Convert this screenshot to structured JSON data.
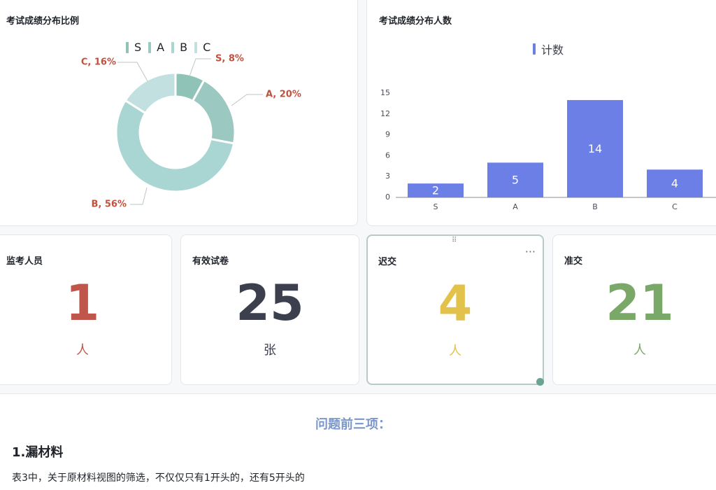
{
  "charts": {
    "donut": {
      "title": "考试成绩分布比例",
      "legend": [
        {
          "label": "S",
          "color": "#8fc3b7"
        },
        {
          "label": "A",
          "color": "#9cc8c2"
        },
        {
          "label": "B",
          "color": "#a9d5d3"
        },
        {
          "label": "C",
          "color": "#c1e0df"
        }
      ],
      "labels": {
        "C": "C, 16%",
        "S": "S, 8%",
        "A": "A, 20%",
        "B": "B, 56%"
      },
      "label_color": "#c0513c"
    },
    "bar": {
      "title": "考试成绩分布人数",
      "legend_label": "计数",
      "bar_color": "#6b7fe6"
    }
  },
  "chart_data": [
    {
      "type": "pie",
      "title": "考试成绩分布比例",
      "categories": [
        "S",
        "A",
        "B",
        "C"
      ],
      "values": [
        8,
        20,
        56,
        16
      ],
      "unit": "%",
      "colors": [
        "#8fc3b7",
        "#9cc8c2",
        "#a9d5d3",
        "#c1e0df"
      ],
      "legend": "top"
    },
    {
      "type": "bar",
      "title": "考试成绩分布人数",
      "categories": [
        "S",
        "A",
        "B",
        "C"
      ],
      "series": [
        {
          "name": "计数",
          "values": [
            2,
            5,
            14,
            4
          ]
        }
      ],
      "ylim": [
        0,
        15
      ],
      "yticks": [
        0,
        3,
        6,
        9,
        12,
        15
      ],
      "grid": false,
      "legend": "top"
    }
  ],
  "kpis": [
    {
      "title": "监考人员",
      "value": "1",
      "unit": "人",
      "color": "#c0564b"
    },
    {
      "title": "有效试卷",
      "value": "25",
      "unit": "张",
      "color": "#3b3f4e"
    },
    {
      "title": "迟交",
      "value": "4",
      "unit": "人",
      "color": "#e2c24a"
    },
    {
      "title": "准交",
      "value": "21",
      "unit": "人",
      "color": "#7aa868"
    }
  ],
  "kpi_card_icons": {
    "drag_handle": "drag-handle-icon",
    "more": "more-icon"
  },
  "document": {
    "heading": "问题前三项：",
    "subheading": "1.漏材料",
    "paragraph": "表3中，关于原材料视图的筛选，不仅仅只有1开头的，还有5开头的"
  }
}
